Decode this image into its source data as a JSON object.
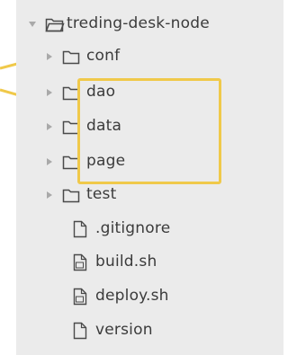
{
  "tree": {
    "root": {
      "label": "treding-desk-node",
      "expanded": true,
      "icon": "folder-icon"
    },
    "items": [
      {
        "label": "conf",
        "type": "folder",
        "icon": "folder-icon"
      },
      {
        "label": "dao",
        "type": "folder",
        "icon": "folder-icon"
      },
      {
        "label": "data",
        "type": "folder",
        "icon": "folder-icon"
      },
      {
        "label": "page",
        "type": "folder",
        "icon": "folder-icon"
      },
      {
        "label": "test",
        "type": "folder",
        "icon": "folder-icon"
      },
      {
        "label": ".gitignore",
        "type": "file",
        "icon": "file-icon"
      },
      {
        "label": "build.sh",
        "type": "file",
        "icon": "script-file-icon"
      },
      {
        "label": "deploy.sh",
        "type": "file",
        "icon": "script-file-icon"
      },
      {
        "label": "version",
        "type": "file",
        "icon": "file-icon"
      }
    ]
  },
  "annotation": {
    "highlight_color": "#f0c94a"
  }
}
